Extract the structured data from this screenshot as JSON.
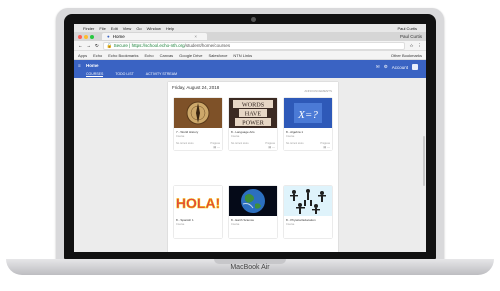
{
  "device": {
    "brand": "MacBook Air"
  },
  "os_menubar": {
    "items": [
      "Finder",
      "File",
      "Edit",
      "View",
      "Go",
      "Window",
      "Help"
    ],
    "right": "Paul Curtis"
  },
  "browser": {
    "tab_title": "Home",
    "tab_close": "×",
    "profile": "Paul Curtis",
    "url_secure": "Secure",
    "url_host": "https://school.echo-nth.org",
    "url_path": "/student/home/courses",
    "bookmarks": [
      "Apps",
      "Echo",
      "Echo Bookmarks",
      "Echo",
      "Canvas",
      "Google Drive",
      "Salesforce",
      "NTN Links"
    ],
    "other_bookmarks": "Other Bookmarks"
  },
  "app": {
    "title": "Home",
    "nav_tabs": [
      "COURSES",
      "TODO LIST",
      "ACTIVITY STREAM"
    ],
    "account": "Account"
  },
  "main": {
    "date": "Friday, August 24, 2018",
    "announcements": "ANNOUNCEMENTS",
    "courses": [
      {
        "title": "7 - World History",
        "meta": "Course",
        "status": "No current score",
        "progress": "Progress"
      },
      {
        "title": "8 - Language Arts",
        "meta": "Course",
        "status": "No current score",
        "progress": "Progress"
      },
      {
        "title": "8 - Algebra 1",
        "meta": "Course",
        "status": "No current score",
        "progress": "Progress"
      },
      {
        "title": "8 - Spanish 1",
        "meta": "Course",
        "status": "",
        "progress": ""
      },
      {
        "title": "8 - Earth Science",
        "meta": "Course",
        "status": "",
        "progress": ""
      },
      {
        "title": "8 - Physical Education",
        "meta": "Course",
        "status": "",
        "progress": ""
      }
    ],
    "thumb_text": {
      "words": "WORDS",
      "have": "HAVE",
      "power": "POWER",
      "algebra": "X=?",
      "hola": "HOLA!"
    }
  },
  "colors": {
    "header_blue": "#3a63c3",
    "card_bg": "#ffffff"
  }
}
